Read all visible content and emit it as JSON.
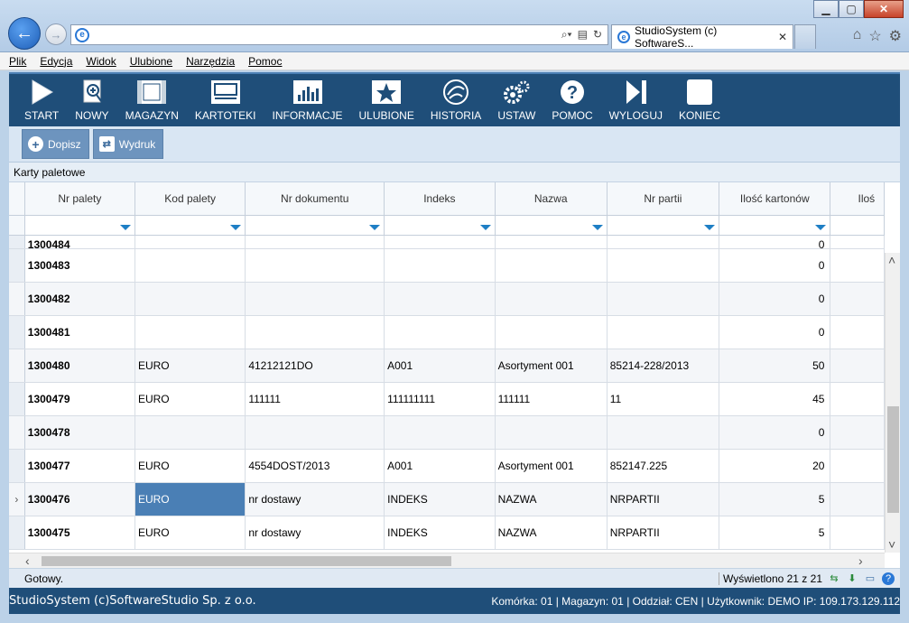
{
  "browser": {
    "tab_title": "StudioSystem (c) SoftwareS...",
    "menu": [
      "Plik",
      "Edycja",
      "Widok",
      "Ulubione",
      "Narzędzia",
      "Pomoc"
    ]
  },
  "toolbar": [
    {
      "label": "START",
      "icon": "play-icon"
    },
    {
      "label": "NOWY",
      "icon": "new-document-icon"
    },
    {
      "label": "MAGAZYN",
      "icon": "warehouse-film-icon"
    },
    {
      "label": "KARTOTEKI",
      "icon": "card-file-icon"
    },
    {
      "label": "INFORMACJE",
      "icon": "bar-chart-icon"
    },
    {
      "label": "ULUBIONE",
      "icon": "star-icon"
    },
    {
      "label": "HISTORIA",
      "icon": "history-icon"
    },
    {
      "label": "USTAW",
      "icon": "gears-icon"
    },
    {
      "label": "POMOC",
      "icon": "help-icon"
    },
    {
      "label": "WYLOGUJ",
      "icon": "logout-icon"
    },
    {
      "label": "KONIEC",
      "icon": "stop-icon"
    }
  ],
  "actions": {
    "add_label": "Dopisz",
    "print_label": "Wydruk"
  },
  "caption": "Karty paletowe",
  "grid": {
    "columns": [
      "Nr palety",
      "Kod palety",
      "Nr dokumentu",
      "Indeks",
      "Nazwa",
      "Nr partii",
      "Ilość kartonów",
      "Iloś"
    ],
    "partial_row": {
      "nr": "1300484",
      "qty": "0"
    },
    "rows": [
      {
        "nr": "1300483",
        "kod": "",
        "dok": "",
        "indeks": "",
        "nazwa": "",
        "partia": "",
        "qty": "0"
      },
      {
        "nr": "1300482",
        "kod": "",
        "dok": "",
        "indeks": "",
        "nazwa": "",
        "partia": "",
        "qty": "0"
      },
      {
        "nr": "1300481",
        "kod": "",
        "dok": "",
        "indeks": "",
        "nazwa": "",
        "partia": "",
        "qty": "0"
      },
      {
        "nr": "1300480",
        "kod": "EURO",
        "dok": "41212121DO",
        "indeks": "A001",
        "nazwa": "Asortyment 001",
        "partia": "85214-228/2013",
        "qty": "50"
      },
      {
        "nr": "1300479",
        "kod": "EURO",
        "dok": "111111",
        "indeks": "111111111",
        "nazwa": "111111",
        "partia": "11",
        "qty": "45"
      },
      {
        "nr": "1300478",
        "kod": "",
        "dok": "",
        "indeks": "",
        "nazwa": "",
        "partia": "",
        "qty": "0"
      },
      {
        "nr": "1300477",
        "kod": "EURO",
        "dok": "4554DOST/2013",
        "indeks": "A001",
        "nazwa": "Asortyment 001",
        "partia": "852147.225",
        "qty": "20"
      },
      {
        "nr": "1300476",
        "kod": "EURO",
        "dok": "nr dostawy",
        "indeks": "INDEKS",
        "nazwa": "NAZWA",
        "partia": "NRPARTII",
        "qty": "5",
        "current": "›"
      },
      {
        "nr": "1300475",
        "kod": "EURO",
        "dok": "nr dostawy",
        "indeks": "INDEKS",
        "nazwa": "NAZWA",
        "partia": "NRPARTII",
        "qty": "5"
      }
    ]
  },
  "status": {
    "text": "Gotowy.",
    "count": "Wyświetlono 21 z 21"
  },
  "footer": {
    "left": "StudioSystem (c)SoftwareStudio Sp. z o.o.",
    "right": "Komórka: 01 | Magazyn: 01 | Oddział: CEN | Użytkownik: DEMO IP: 109.173.129.112"
  }
}
